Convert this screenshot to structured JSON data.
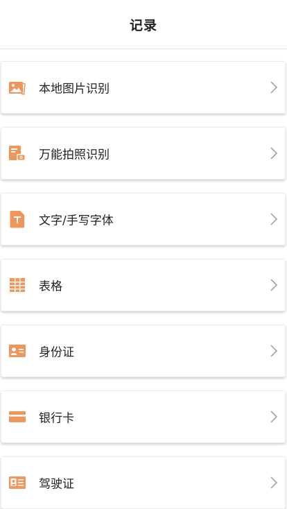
{
  "header": {
    "title": "记录"
  },
  "accent_color": "#F0965A",
  "items": [
    {
      "label": "本地图片识别",
      "icon": "image-icon"
    },
    {
      "label": "万能拍照识别",
      "icon": "camera-doc-icon"
    },
    {
      "label": "文字/手写字体",
      "icon": "text-doc-icon"
    },
    {
      "label": "表格",
      "icon": "table-icon"
    },
    {
      "label": "身份证",
      "icon": "id-card-icon"
    },
    {
      "label": "银行卡",
      "icon": "bank-card-icon"
    },
    {
      "label": "驾驶证",
      "icon": "driver-license-icon"
    }
  ]
}
